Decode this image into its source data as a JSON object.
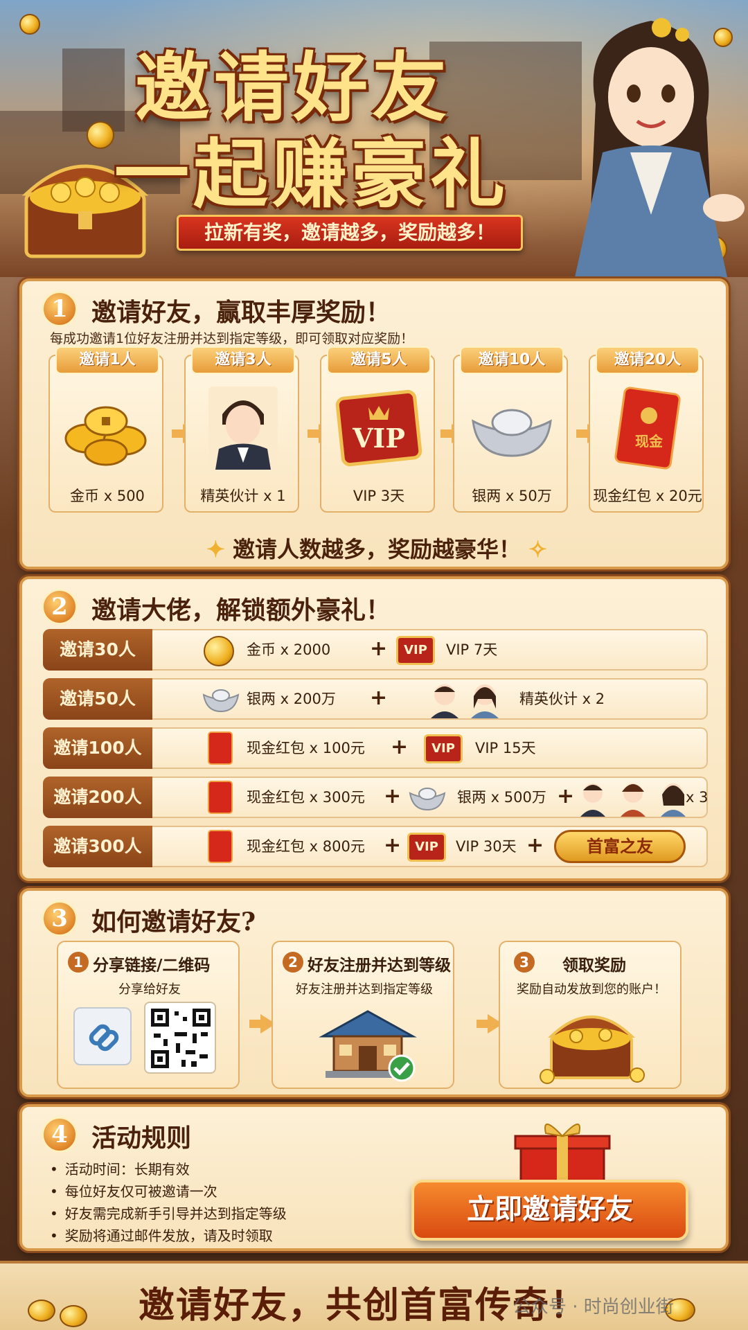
{
  "header": {
    "title_line1": "邀请好友",
    "title_line2": "一起赚豪礼",
    "ribbon": "拉新有奖，邀请越多，奖励越多！"
  },
  "section1": {
    "number": "1",
    "title": "邀请好友，赢取丰厚奖励！",
    "subtitle": "每成功邀请1位好友注册并达到指定等级，即可领取对应奖励！",
    "tiers": [
      {
        "tag": "邀请1人",
        "label": "金币 x 500",
        "icon": "gold-coins-icon"
      },
      {
        "tag": "邀请3人",
        "label": "精英伙计 x 1",
        "icon": "elite-partner-icon"
      },
      {
        "tag": "邀请5人",
        "label": "VIP 3天",
        "icon": "vip-card-icon"
      },
      {
        "tag": "邀请10人",
        "label": "银两 x 50万",
        "icon": "silver-ingot-icon"
      },
      {
        "tag": "邀请20人",
        "label": "现金红包 x 20元",
        "icon": "red-envelope-icon"
      }
    ],
    "tagline": "邀请人数越多，奖励越豪华！",
    "envelope_text": "现金",
    "vip_text": "VIP"
  },
  "section2": {
    "number": "2",
    "title": "邀请大佬，解锁额外豪礼！",
    "rows": [
      {
        "tag": "邀请30人",
        "items": [
          "金币 x 2000",
          "VIP 7天"
        ]
      },
      {
        "tag": "邀请50人",
        "items": [
          "银两 x 200万",
          "精英伙计 x 2"
        ]
      },
      {
        "tag": "邀请100人",
        "items": [
          "现金红包 x 100元",
          "VIP 15天"
        ]
      },
      {
        "tag": "邀请200人",
        "items": [
          "现金红包 x 300元",
          "银两 x 500万",
          "x 3"
        ]
      },
      {
        "tag": "邀请300人",
        "items": [
          "现金红包 x 800元",
          "VIP 30天"
        ]
      }
    ],
    "plus": "+",
    "badge": "首富之友"
  },
  "section3": {
    "number": "3",
    "title": "如何邀请好友?",
    "steps": [
      {
        "num": "1",
        "title": "分享链接/二维码",
        "sub": "分享给好友"
      },
      {
        "num": "2",
        "title": "好友注册并达到等级",
        "sub": "好友注册并达到指定等级"
      },
      {
        "num": "3",
        "title": "领取奖励",
        "sub": "奖励自动发放到您的账户！"
      }
    ]
  },
  "section4": {
    "number": "4",
    "title": "活动规则",
    "rules": [
      "活动时间：长期有效",
      "每位好友仅可被邀请一次",
      "好友需完成新手引导并达到指定等级",
      "奖励将通过邮件发放，请及时领取"
    ],
    "cta": "立即邀请好友"
  },
  "footer": {
    "text": "邀请好友，共创首富传奇！",
    "watermark": "公众号 · 时尚创业街"
  }
}
